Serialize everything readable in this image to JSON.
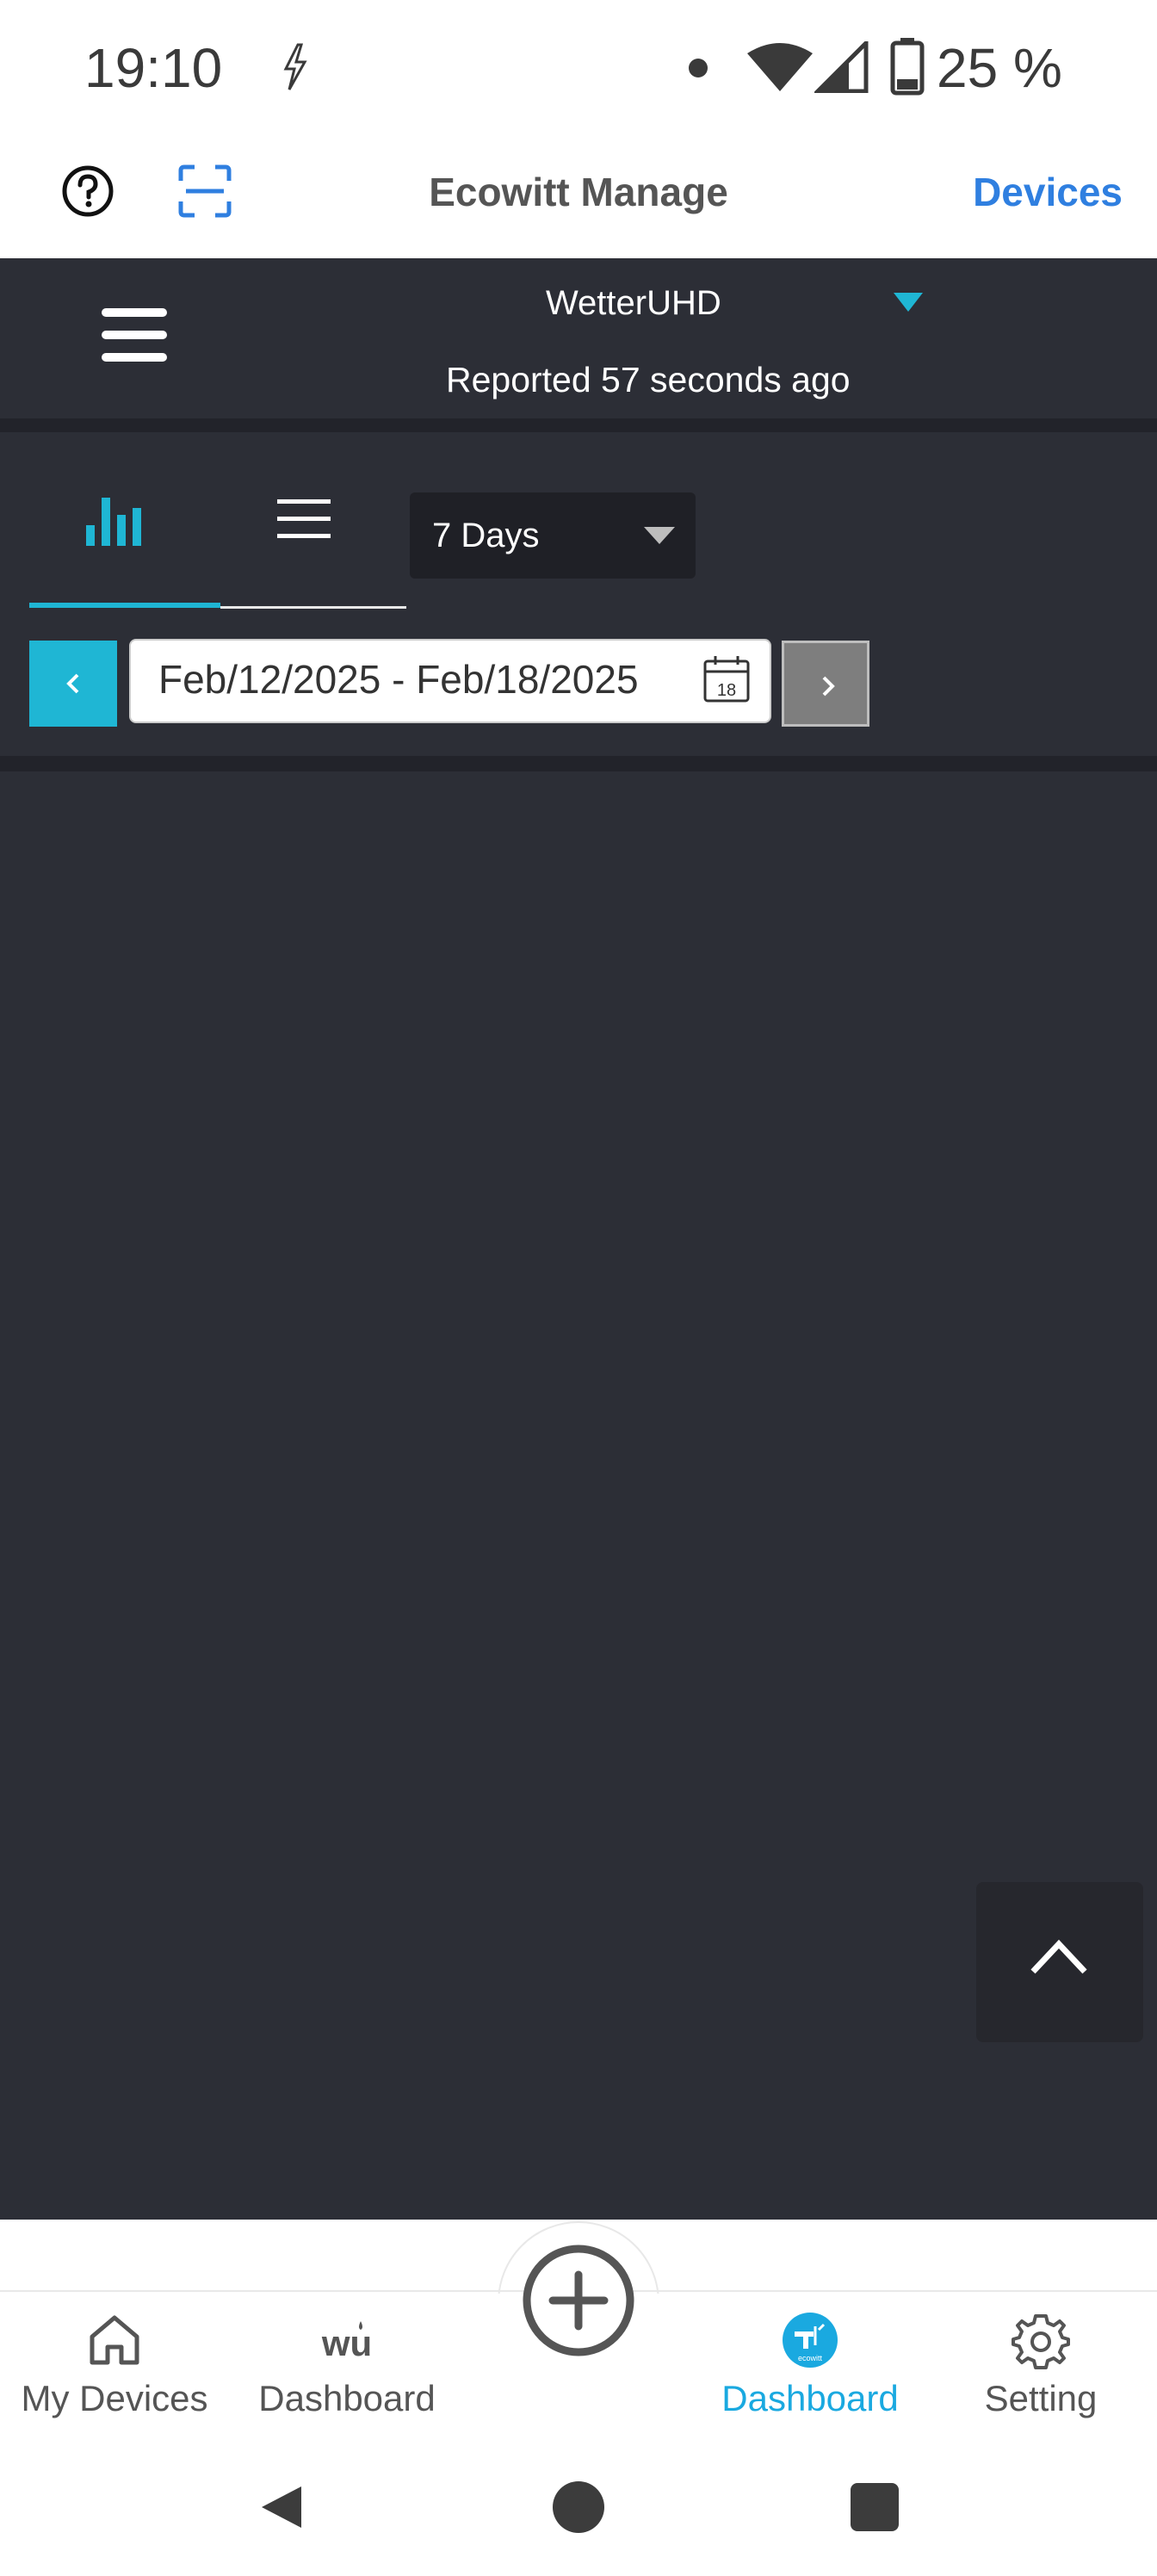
{
  "status_bar": {
    "time": "19:10",
    "battery": "25 %"
  },
  "header": {
    "title": "Ecowitt Manage",
    "devices_link": "Devices",
    "icons": [
      "help-icon",
      "scan-icon"
    ]
  },
  "device": {
    "name": "WetterUHD",
    "reported": "Reported 57 seconds ago"
  },
  "view_tabs": [
    {
      "name": "chart",
      "icon": "bar-chart-icon",
      "active": true
    },
    {
      "name": "list",
      "icon": "list-icon",
      "active": false
    }
  ],
  "range": {
    "selected": "7 Days",
    "date_range": "Feb/12/2025 - Feb/18/2025",
    "calendar_day": "18"
  },
  "bottom_nav": [
    {
      "label": "My Devices",
      "icon": "home-icon",
      "active": false
    },
    {
      "label": "Dashboard",
      "icon": "wu-icon",
      "active": false
    },
    {
      "label": "Dashboard",
      "icon": "ecowitt-icon",
      "active": true
    },
    {
      "label": "Setting",
      "icon": "gear-icon",
      "active": false
    }
  ],
  "colors": {
    "accent": "#1fb6d4",
    "link": "#2f7fe0",
    "dark_bg": "#2c2e36",
    "active_nav": "#1aa9e0"
  }
}
